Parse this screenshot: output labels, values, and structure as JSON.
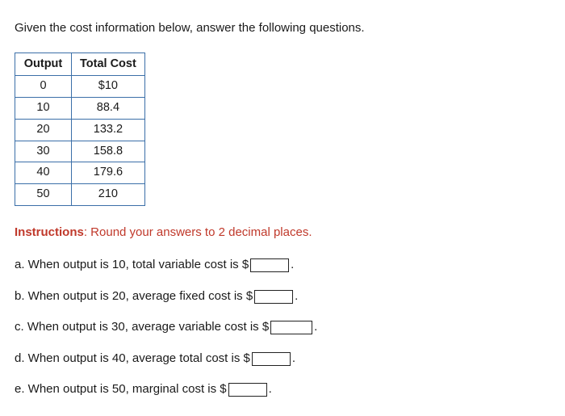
{
  "intro": "Given the cost information below, answer the following questions.",
  "table": {
    "headers": [
      "Output",
      "Total Cost"
    ],
    "rows": [
      {
        "output": "0",
        "cost": "$10"
      },
      {
        "output": "10",
        "cost": "88.4"
      },
      {
        "output": "20",
        "cost": "133.2"
      },
      {
        "output": "30",
        "cost": "158.8"
      },
      {
        "output": "40",
        "cost": "179.6"
      },
      {
        "output": "50",
        "cost": "210"
      }
    ]
  },
  "instructions": {
    "label": "Instructions",
    "text": ": Round your answers to 2 decimal places."
  },
  "questions": {
    "a": {
      "prefix": "a. When output is 10, total variable cost is $",
      "suffix": "."
    },
    "b": {
      "prefix": "b. When output is 20, average fixed cost is $",
      "suffix": "."
    },
    "c": {
      "prefix": "c. When output is 30, average variable cost is $",
      "suffix": "."
    },
    "d": {
      "prefix": "d. When output is 40, average total cost is $",
      "suffix": "."
    },
    "e": {
      "prefix": "e. When output is 50, marginal cost is $",
      "suffix": "."
    }
  }
}
